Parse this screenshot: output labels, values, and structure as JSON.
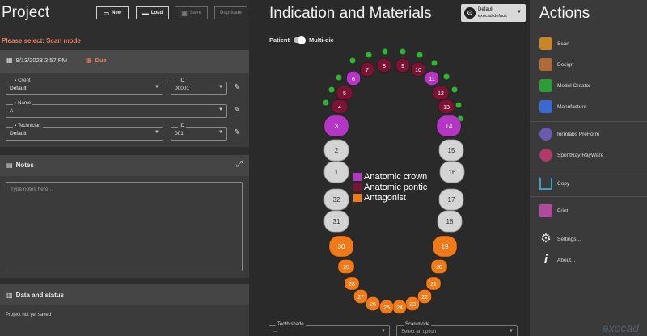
{
  "project": {
    "title": "Project",
    "buttons": {
      "new": "New",
      "load": "Load",
      "save": "Save",
      "duplicate": "Duplicate"
    },
    "select_prompt": "Please select:  Scan mode",
    "date": "9/13/2023 2:57 PM",
    "due": "Due",
    "client": {
      "label": "Client",
      "value": "Default",
      "id_label": "ID",
      "id_value": "00001"
    },
    "name": {
      "label": "Name",
      "value": "A"
    },
    "technician": {
      "label": "Technician",
      "value": "Default",
      "id_label": "ID",
      "id_value": "001"
    },
    "notes": {
      "title": "Notes",
      "placeholder": "Type notes here..."
    },
    "data": {
      "title": "Data and status",
      "status": "Project not yet saved"
    }
  },
  "indication": {
    "title": "Indication and Materials",
    "profile": {
      "line1": "Default",
      "line2": "exocad default"
    },
    "patient_label": "Patient",
    "multidie_label": "Multi-die",
    "legend": [
      {
        "label": "Anatomic crown",
        "color": "#b536c4"
      },
      {
        "label": "Anatomic pontic",
        "color": "#7a1434"
      },
      {
        "label": "Antagonist",
        "color": "#f07a1a"
      }
    ],
    "tooth_shade": {
      "label": "Tooth shade",
      "value": "--"
    },
    "scan_mode": {
      "label": "Scan mode",
      "value": "Select an option"
    }
  },
  "chart_data": {
    "type": "tooth-chart",
    "upper": [
      {
        "n": 1,
        "state": "none"
      },
      {
        "n": 2,
        "state": "none"
      },
      {
        "n": 3,
        "state": "crown"
      },
      {
        "n": 4,
        "state": "pontic"
      },
      {
        "n": 5,
        "state": "pontic"
      },
      {
        "n": 6,
        "state": "crown"
      },
      {
        "n": 7,
        "state": "pontic"
      },
      {
        "n": 8,
        "state": "pontic"
      },
      {
        "n": 9,
        "state": "pontic"
      },
      {
        "n": 10,
        "state": "pontic"
      },
      {
        "n": 11,
        "state": "crown"
      },
      {
        "n": 12,
        "state": "pontic"
      },
      {
        "n": 13,
        "state": "pontic"
      },
      {
        "n": 14,
        "state": "crown"
      },
      {
        "n": 15,
        "state": "none"
      },
      {
        "n": 16,
        "state": "none"
      }
    ],
    "lower": [
      {
        "n": 17,
        "state": "none"
      },
      {
        "n": 18,
        "state": "none"
      },
      {
        "n": 19,
        "state": "antagonist"
      },
      {
        "n": 20,
        "state": "antagonist"
      },
      {
        "n": 21,
        "state": "antagonist"
      },
      {
        "n": 22,
        "state": "antagonist"
      },
      {
        "n": 23,
        "state": "antagonist"
      },
      {
        "n": 24,
        "state": "antagonist"
      },
      {
        "n": 25,
        "state": "antagonist"
      },
      {
        "n": 26,
        "state": "antagonist"
      },
      {
        "n": 27,
        "state": "antagonist"
      },
      {
        "n": 28,
        "state": "antagonist"
      },
      {
        "n": 29,
        "state": "antagonist"
      },
      {
        "n": 30,
        "state": "antagonist"
      },
      {
        "n": 31,
        "state": "none"
      },
      {
        "n": 32,
        "state": "none"
      }
    ],
    "colors": {
      "crown": "#b536c4",
      "pontic": "#7a1434",
      "antagonist": "#f07a1a",
      "none": "#d4d4d4",
      "connector": "#2fb52f"
    }
  },
  "actions": {
    "title": "Actions",
    "items": [
      {
        "label": "Scan",
        "icon": "scan-icon",
        "color": "#c8862a"
      },
      {
        "label": "Design",
        "icon": "design-icon",
        "color": "#b06a3a"
      },
      {
        "label": "Model Creator",
        "icon": "model-creator-icon",
        "color": "#2f9a3a"
      },
      {
        "label": "Manufacture",
        "icon": "manufacture-icon",
        "color": "#3a6ad0"
      }
    ],
    "integrations": [
      {
        "label": "formlabs PreForm",
        "icon": "formlabs-icon",
        "color": "#6a5ab0"
      },
      {
        "label": "SprintRay RayWare",
        "icon": "sprintray-icon",
        "color": "#b03a6a"
      }
    ],
    "copy": "Copy",
    "print": "Print",
    "settings": "Settings...",
    "about": "About...",
    "logo": "exocad"
  }
}
